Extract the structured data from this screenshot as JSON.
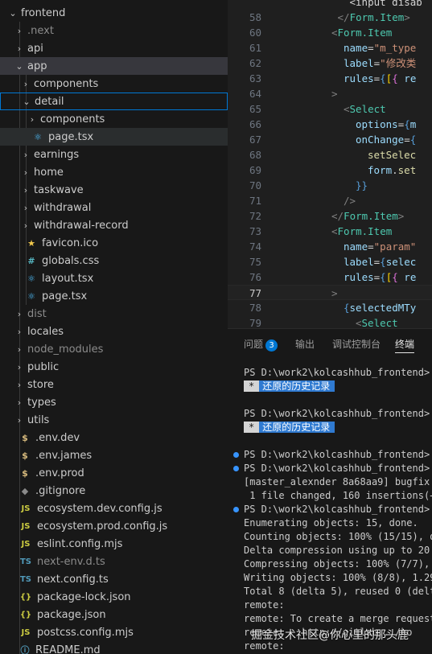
{
  "explorer": {
    "items": [
      {
        "label": "frontend",
        "level": 0,
        "chevron": "open",
        "icon": "",
        "dim": false
      },
      {
        "label": ".next",
        "level": 1,
        "chevron": "closed",
        "icon": "",
        "dim": true
      },
      {
        "label": "api",
        "level": 1,
        "chevron": "closed",
        "icon": "",
        "dim": false
      },
      {
        "label": "app",
        "level": 1,
        "chevron": "open",
        "icon": "",
        "dim": false,
        "selected": true
      },
      {
        "label": "components",
        "level": 2,
        "chevron": "closed",
        "icon": "",
        "dim": false
      },
      {
        "label": "detail",
        "level": 2,
        "chevron": "open",
        "icon": "",
        "dim": false,
        "focused": true
      },
      {
        "label": "components",
        "level": 3,
        "chevron": "closed",
        "icon": "",
        "dim": false
      },
      {
        "label": "page.tsx",
        "level": 3,
        "chevron": "none",
        "icon": "react-icon",
        "dim": false,
        "active": true
      },
      {
        "label": "earnings",
        "level": 2,
        "chevron": "closed",
        "icon": "",
        "dim": false
      },
      {
        "label": "home",
        "level": 2,
        "chevron": "closed",
        "icon": "",
        "dim": false
      },
      {
        "label": "taskwave",
        "level": 2,
        "chevron": "closed",
        "icon": "",
        "dim": false
      },
      {
        "label": "withdrawal",
        "level": 2,
        "chevron": "closed",
        "icon": "",
        "dim": false
      },
      {
        "label": "withdrawal-record",
        "level": 2,
        "chevron": "closed",
        "icon": "",
        "dim": false
      },
      {
        "label": "favicon.ico",
        "level": 2,
        "chevron": "none",
        "icon": "star-icon",
        "dim": false
      },
      {
        "label": "globals.css",
        "level": 2,
        "chevron": "none",
        "icon": "hash-icon",
        "dim": false
      },
      {
        "label": "layout.tsx",
        "level": 2,
        "chevron": "none",
        "icon": "react-icon",
        "dim": false
      },
      {
        "label": "page.tsx",
        "level": 2,
        "chevron": "none",
        "icon": "react-icon",
        "dim": false
      },
      {
        "label": "dist",
        "level": 1,
        "chevron": "closed",
        "icon": "",
        "dim": true
      },
      {
        "label": "locales",
        "level": 1,
        "chevron": "closed",
        "icon": "",
        "dim": false
      },
      {
        "label": "node_modules",
        "level": 1,
        "chevron": "closed",
        "icon": "",
        "dim": true
      },
      {
        "label": "public",
        "level": 1,
        "chevron": "closed",
        "icon": "",
        "dim": false
      },
      {
        "label": "store",
        "level": 1,
        "chevron": "closed",
        "icon": "",
        "dim": false
      },
      {
        "label": "types",
        "level": 1,
        "chevron": "closed",
        "icon": "",
        "dim": false
      },
      {
        "label": "utils",
        "level": 1,
        "chevron": "closed",
        "icon": "",
        "dim": false
      },
      {
        "label": ".env.dev",
        "level": 1,
        "chevron": "none",
        "icon": "dollar-icon",
        "dim": false
      },
      {
        "label": ".env.james",
        "level": 1,
        "chevron": "none",
        "icon": "dollar-icon",
        "dim": false
      },
      {
        "label": ".env.prod",
        "level": 1,
        "chevron": "none",
        "icon": "dollar-icon",
        "dim": false
      },
      {
        "label": ".gitignore",
        "level": 1,
        "chevron": "none",
        "icon": "git-icon",
        "dim": false
      },
      {
        "label": "ecosystem.dev.config.js",
        "level": 1,
        "chevron": "none",
        "icon": "js-icon",
        "dim": false
      },
      {
        "label": "ecosystem.prod.config.js",
        "level": 1,
        "chevron": "none",
        "icon": "js-icon",
        "dim": false
      },
      {
        "label": "eslint.config.mjs",
        "level": 1,
        "chevron": "none",
        "icon": "js-icon",
        "dim": false
      },
      {
        "label": "next-env.d.ts",
        "level": 1,
        "chevron": "none",
        "icon": "ts-icon",
        "dim": true
      },
      {
        "label": "next.config.ts",
        "level": 1,
        "chevron": "none",
        "icon": "ts-icon",
        "dim": false
      },
      {
        "label": "package-lock.json",
        "level": 1,
        "chevron": "none",
        "icon": "json-icon",
        "dim": false
      },
      {
        "label": "package.json",
        "level": 1,
        "chevron": "none",
        "icon": "json-icon",
        "dim": false
      },
      {
        "label": "postcss.config.mjs",
        "level": 1,
        "chevron": "none",
        "icon": "js-icon",
        "dim": false
      },
      {
        "label": "README.md",
        "level": 1,
        "chevron": "none",
        "icon": "info-icon",
        "dim": false
      }
    ]
  },
  "editor": {
    "current_line": 77,
    "lines": [
      {
        "num": "",
        "indent": 6,
        "tokens": [
          {
            "t": "<input disab",
            "c": "tok-plain"
          }
        ]
      },
      {
        "num": "58",
        "indent": 4,
        "tokens": [
          {
            "t": "</",
            "c": "tok-brk"
          },
          {
            "t": "Form.Item",
            "c": "tok-tag"
          },
          {
            "t": ">",
            "c": "tok-brk"
          }
        ]
      },
      {
        "num": "60",
        "indent": 3,
        "tokens": [
          {
            "t": "<",
            "c": "tok-brk"
          },
          {
            "t": "Form.Item",
            "c": "tok-tag"
          }
        ]
      },
      {
        "num": "61",
        "indent": 5,
        "tokens": [
          {
            "t": "name",
            "c": "tok-attr"
          },
          {
            "t": "=",
            "c": "tok-plain"
          },
          {
            "t": "\"m_type",
            "c": "tok-str"
          }
        ]
      },
      {
        "num": "62",
        "indent": 5,
        "tokens": [
          {
            "t": "label",
            "c": "tok-attr"
          },
          {
            "t": "=",
            "c": "tok-plain"
          },
          {
            "t": "\"修改类",
            "c": "tok-str"
          }
        ]
      },
      {
        "num": "63",
        "indent": 5,
        "tokens": [
          {
            "t": "rules",
            "c": "tok-attr"
          },
          {
            "t": "=",
            "c": "tok-plain"
          },
          {
            "t": "{",
            "c": "tok-kw"
          },
          {
            "t": "[",
            "c": "tok-br1"
          },
          {
            "t": "{",
            "c": "tok-br2"
          },
          {
            "t": " re",
            "c": "tok-attr"
          }
        ]
      },
      {
        "num": "64",
        "indent": 3,
        "tokens": [
          {
            "t": ">",
            "c": "tok-brk"
          }
        ]
      },
      {
        "num": "65",
        "indent": 5,
        "tokens": [
          {
            "t": "<",
            "c": "tok-brk"
          },
          {
            "t": "Select",
            "c": "tok-tag"
          }
        ]
      },
      {
        "num": "66",
        "indent": 7,
        "tokens": [
          {
            "t": "options",
            "c": "tok-attr"
          },
          {
            "t": "=",
            "c": "tok-plain"
          },
          {
            "t": "{",
            "c": "tok-kw"
          },
          {
            "t": "m",
            "c": "tok-attr"
          }
        ]
      },
      {
        "num": "67",
        "indent": 7,
        "tokens": [
          {
            "t": "onChange",
            "c": "tok-attr"
          },
          {
            "t": "=",
            "c": "tok-plain"
          },
          {
            "t": "{",
            "c": "tok-kw"
          }
        ]
      },
      {
        "num": "68",
        "indent": 9,
        "tokens": [
          {
            "t": "setSelec",
            "c": "tok-fn"
          }
        ]
      },
      {
        "num": "69",
        "indent": 9,
        "tokens": [
          {
            "t": "form",
            "c": "tok-attr"
          },
          {
            "t": ".",
            "c": "tok-plain"
          },
          {
            "t": "set",
            "c": "tok-fn"
          }
        ]
      },
      {
        "num": "70",
        "indent": 7,
        "tokens": [
          {
            "t": "}}",
            "c": "tok-kw"
          }
        ]
      },
      {
        "num": "71",
        "indent": 5,
        "tokens": [
          {
            "t": "/>",
            "c": "tok-brk"
          }
        ]
      },
      {
        "num": "72",
        "indent": 3,
        "tokens": [
          {
            "t": "</",
            "c": "tok-brk"
          },
          {
            "t": "Form.Item",
            "c": "tok-tag"
          },
          {
            "t": ">",
            "c": "tok-brk"
          }
        ]
      },
      {
        "num": "73",
        "indent": 3,
        "tokens": [
          {
            "t": "<",
            "c": "tok-brk"
          },
          {
            "t": "Form.Item",
            "c": "tok-tag"
          }
        ]
      },
      {
        "num": "74",
        "indent": 5,
        "tokens": [
          {
            "t": "name",
            "c": "tok-attr"
          },
          {
            "t": "=",
            "c": "tok-plain"
          },
          {
            "t": "\"param\"",
            "c": "tok-str"
          }
        ]
      },
      {
        "num": "75",
        "indent": 5,
        "tokens": [
          {
            "t": "label",
            "c": "tok-attr"
          },
          {
            "t": "=",
            "c": "tok-plain"
          },
          {
            "t": "{",
            "c": "tok-kw"
          },
          {
            "t": "selec",
            "c": "tok-attr"
          }
        ]
      },
      {
        "num": "76",
        "indent": 5,
        "tokens": [
          {
            "t": "rules",
            "c": "tok-attr"
          },
          {
            "t": "=",
            "c": "tok-plain"
          },
          {
            "t": "{",
            "c": "tok-kw"
          },
          {
            "t": "[",
            "c": "tok-br1"
          },
          {
            "t": "{",
            "c": "tok-br2"
          },
          {
            "t": " re",
            "c": "tok-attr"
          }
        ]
      },
      {
        "num": "77",
        "indent": 3,
        "tokens": [
          {
            "t": ">",
            "c": "tok-brk"
          }
        ]
      },
      {
        "num": "78",
        "indent": 5,
        "tokens": [
          {
            "t": "{",
            "c": "tok-kw"
          },
          {
            "t": "selectedMTy",
            "c": "tok-attr"
          }
        ]
      },
      {
        "num": "79",
        "indent": 7,
        "tokens": [
          {
            "t": "<",
            "c": "tok-brk"
          },
          {
            "t": "Select",
            "c": "tok-tag"
          }
        ]
      }
    ]
  },
  "panel": {
    "tabs": [
      {
        "label": "问题",
        "badge": "3",
        "active": false
      },
      {
        "label": "输出",
        "active": false
      },
      {
        "label": "调试控制台",
        "active": false
      },
      {
        "label": "终端",
        "active": true
      }
    ],
    "terminal": [
      {
        "type": "text",
        "text": "PS D:\\work2\\kolcashhub_frontend>",
        "dot": false
      },
      {
        "type": "history",
        "star": "*",
        "text": "还原的历史记录"
      },
      {
        "type": "blank"
      },
      {
        "type": "text",
        "text": "PS D:\\work2\\kolcashhub_frontend>",
        "dot": false
      },
      {
        "type": "history",
        "star": "*",
        "text": "还原的历史记录"
      },
      {
        "type": "blank"
      },
      {
        "type": "text",
        "text": "PS D:\\work2\\kolcashhub_frontend> g",
        "dot": true
      },
      {
        "type": "text",
        "text": "PS D:\\work2\\kolcashhub_frontend> g",
        "dot": true
      },
      {
        "type": "text",
        "text": "[master_alexnder 8a68aa9] bugfix:",
        "dot": false
      },
      {
        "type": "text",
        "text": " 1 file changed, 160 insertions(+)",
        "dot": false
      },
      {
        "type": "text",
        "text": "PS D:\\work2\\kolcashhub_frontend> g",
        "dot": true
      },
      {
        "type": "text",
        "text": "Enumerating objects: 15, done.",
        "dot": false
      },
      {
        "type": "text",
        "text": "Counting objects: 100% (15/15), do",
        "dot": false
      },
      {
        "type": "text",
        "text": "Delta compression using up to 20 t",
        "dot": false
      },
      {
        "type": "text",
        "text": "Compressing objects: 100% (7/7), d",
        "dot": false
      },
      {
        "type": "text",
        "text": "Writing objects: 100% (8/8), 1.29",
        "dot": false
      },
      {
        "type": "text",
        "text": "Total 8 (delta 5), reused 0 (delta",
        "dot": false
      },
      {
        "type": "text",
        "text": "remote:",
        "dot": false
      },
      {
        "type": "text",
        "text": "remote: To create a merge request",
        "dot": false
      },
      {
        "type": "text",
        "text": "remote:   http://gitlab.../ko",
        "dot": false
      },
      {
        "type": "text",
        "text": "remote:",
        "dot": false
      }
    ],
    "watermark": "掘金技术社区@你心里的那头鹿"
  }
}
